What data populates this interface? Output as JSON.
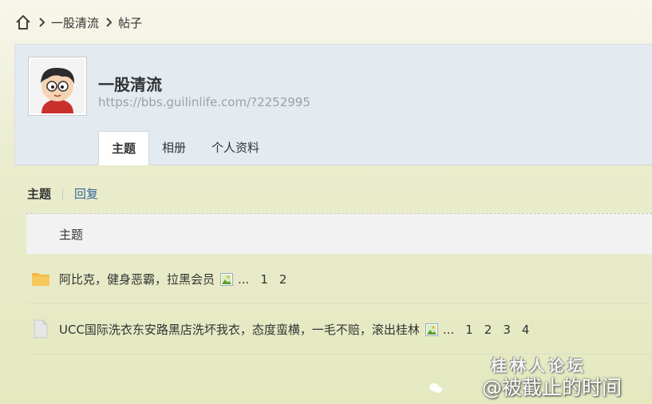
{
  "breadcrumb": {
    "home_icon": "home-icon",
    "items": [
      "一股清流",
      "帖子"
    ]
  },
  "profile": {
    "name": "一股清流",
    "url": "https://bbs.guilinlife.com/?2252995",
    "tabs": [
      "主题",
      "相册",
      "个人资料"
    ],
    "active_tab": "主题"
  },
  "subtabs": {
    "active": "主题",
    "other": "回复"
  },
  "thread_table": {
    "header": "主题",
    "rows": [
      {
        "icon": "folder-icon",
        "title": "阿比克，健身恶霸，拉黑会员",
        "has_image": true,
        "ellipsis": "...",
        "pages": [
          "1",
          "2"
        ]
      },
      {
        "icon": "document-icon",
        "title": "UCC国际洗衣东安路黑店洗坏我衣，态度蛮横，一毛不赔，滚出桂林",
        "has_image": true,
        "ellipsis": "...",
        "pages": [
          "1",
          "2",
          "3",
          "4"
        ]
      }
    ]
  },
  "watermark": {
    "site": "桂林人论坛",
    "mark": "@被截止的时间"
  },
  "colors": {
    "header_bg": "#e3ebf1",
    "link": "#336699",
    "folder": "#f5b942"
  }
}
